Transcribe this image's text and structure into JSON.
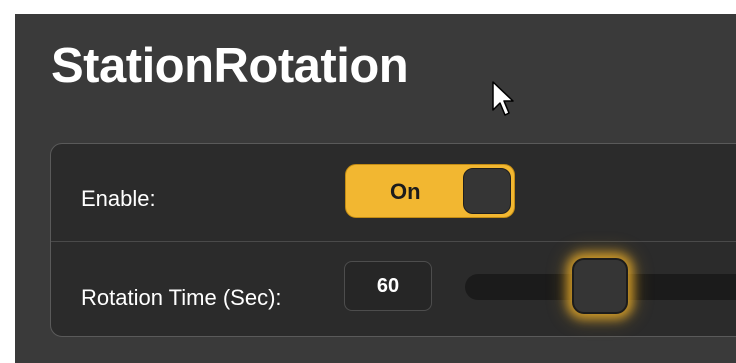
{
  "page": {
    "title": "StationRotation"
  },
  "settings": {
    "enable": {
      "label": "Enable:",
      "state": "On",
      "is_on": true
    },
    "rotation_time": {
      "label": "Rotation Time (Sec):",
      "value": "60"
    }
  },
  "colors": {
    "background": "#3a3a3a",
    "panel": "#2b2b2b",
    "accent": "#f2b731",
    "text": "#ffffff"
  },
  "icons": {
    "cursor": "mouse-pointer-icon"
  }
}
